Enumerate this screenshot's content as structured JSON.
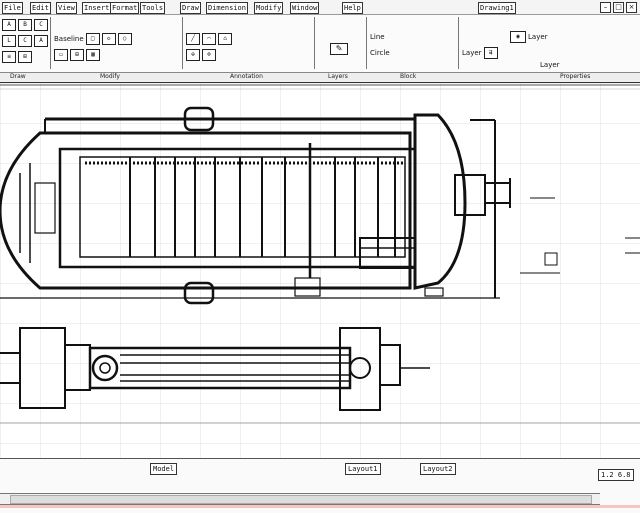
{
  "titlebar": {
    "menus": [
      "File",
      "Edit",
      "View",
      "Insert",
      "Format",
      "Tools",
      "Draw",
      "Dimension",
      "Modify",
      "Window",
      "Help"
    ],
    "status_title": "Drawing1"
  },
  "ribbon": {
    "group1": {
      "row1": [
        "A",
        "B",
        "C"
      ],
      "row2_label": "Baseline",
      "row3": [
        "L",
        "C",
        "A"
      ]
    },
    "group2": {
      "row1": [
        "□",
        "◇",
        "○"
      ],
      "row2": [
        "▭",
        "⊞",
        "▦"
      ]
    },
    "group3": {
      "row1": [
        "╱",
        "⌒",
        "⌂"
      ],
      "row2": [
        "⊕",
        "⊗"
      ]
    },
    "group4_icon": "✎",
    "group5": {
      "row1_label": "Line",
      "row2_label": "Circle"
    },
    "group6": {
      "row1_label": "Layer",
      "row2_label": "Layer",
      "row3_label": "Layer"
    },
    "group_labels": [
      "Draw",
      "Modify",
      "Annotation",
      "Layers",
      "Block",
      "Properties"
    ]
  },
  "status": {
    "cells": [
      "Model",
      "Layout1",
      "Layout2"
    ],
    "coords": "1.2 6.8"
  },
  "colors": {
    "accent": "#111111",
    "grid": "#d8d8d8",
    "status_pink": "#f3c7c7"
  }
}
